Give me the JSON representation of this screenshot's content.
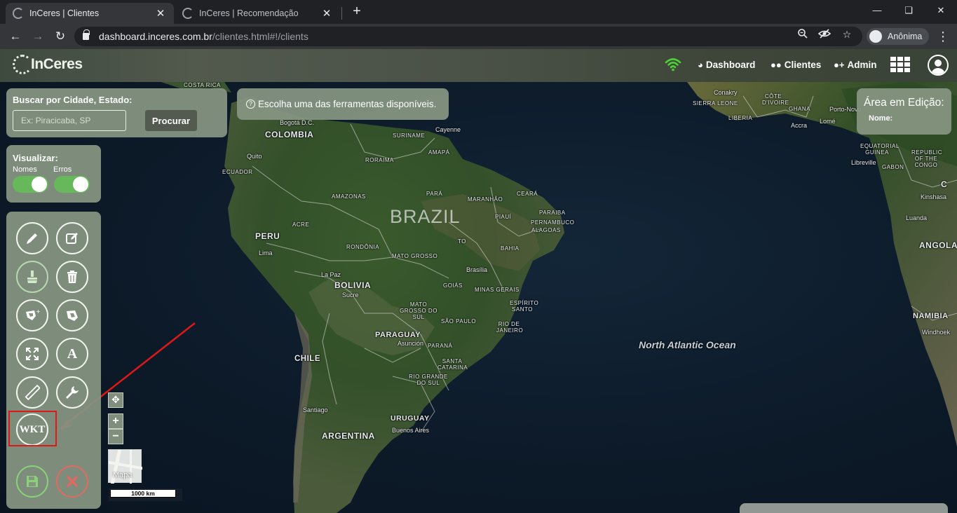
{
  "browser": {
    "tabs": [
      {
        "title": "InCeres | Clientes",
        "close": "✕"
      },
      {
        "title": "InCeres | Recomendação",
        "close": "✕"
      }
    ],
    "new_tab": "+",
    "url_host": "dashboard.inceres.com.br",
    "url_path": "/clientes.html#!/clients",
    "profile_label": "Anônima"
  },
  "header": {
    "logo": "InCeres",
    "nav": [
      {
        "label": "Dashboard",
        "icon": "dashboard-icon"
      },
      {
        "label": "Clientes",
        "icon": "users-icon"
      },
      {
        "label": "Admin",
        "icon": "user-plus-icon"
      }
    ],
    "wifi_color": "#4cd137"
  },
  "search": {
    "title": "Buscar por Cidade, Estado:",
    "placeholder": "Ex: Piracicaba, SP",
    "value": "",
    "button": "Procurar"
  },
  "hint": {
    "text": "Escolha uma das ferramentas disponíveis."
  },
  "view": {
    "title": "Visualizar:",
    "toggles": [
      {
        "label": "Nomes",
        "on": true
      },
      {
        "label": "Erros",
        "on": true
      }
    ]
  },
  "tools": {
    "buttons": [
      "pencil-icon",
      "edit-icon",
      "paint-icon",
      "trash-icon",
      "polygon-add-icon",
      "polygon-cut-icon",
      "expand-icon",
      "text-icon",
      "ruler-icon",
      "wrench-icon",
      "wkt-icon",
      "save-icon",
      "cancel-icon"
    ],
    "text_label": "A",
    "wkt_label": "WKT"
  },
  "edit_area": {
    "title": "Área em Edição:",
    "name_label": "Nome:",
    "name_value": ""
  },
  "map": {
    "controls": {
      "zoom_in": "+",
      "zoom_out": "−",
      "pan": "✥"
    },
    "minimap_label": "Mapa",
    "scale_label": "1000 km",
    "labels": {
      "costa_rica": "COSTA RICA",
      "bogota": "Bogotá D.C.",
      "colombia": "COLOMBIA",
      "quito": "Quito",
      "ecuador": "ECUADOR",
      "peru": "PERU",
      "lima": "Lima",
      "suriname": "SURINAME",
      "cayenne": "Cayenne",
      "amapa": "AMAPÁ",
      "roraima": "RORAIMA",
      "amazonas": "AMAZONAS",
      "para": "PARÁ",
      "maranhao": "MARANHÃO",
      "ceara": "CEARÁ",
      "piaui": "PIAUÍ",
      "paraiba": "PARAIBA",
      "pernambuco": "PERNAMBUCO",
      "alagoas": "ALAGOAS",
      "brazil": "BRAZIL",
      "acre": "ACRE",
      "rondonia": "RONDÔNIA",
      "to": "TO",
      "bahia": "BAHIA",
      "mato_grosso": "MATO GROSSO",
      "la_paz": "La Paz",
      "bolivia": "BOLIVIA",
      "sucre": "Sucre",
      "brasilia": "Brasília",
      "goias": "GOIÁS",
      "minas_gerais": "MINAS GERAIS",
      "espirito_santo": "ESPÍRITO SANTO",
      "ms": "MATO GROSSO DO SUL",
      "sao_paulo": "SÃO PAULO",
      "rio": "RIO DE JANEIRO",
      "paraguay": "PARAGUAY",
      "asuncion": "Asunción",
      "parana": "PARANÁ",
      "santa_catarina": "SANTA CATARINA",
      "rs": "RIO GRANDE DO SUL",
      "chile": "CHILE",
      "santiago": "Santiago",
      "uruguay": "URUGUAY",
      "buenos_aires": "Buenos Aires",
      "argentina": "ARGENTINA",
      "ocean": "North Atlantic Ocean",
      "conakry": "Conakry",
      "sierra_leone": "SIERRA LEONE",
      "liberia": "LIBERIA",
      "cote_divoire": "CÔTE D'IVOIRE",
      "ghana": "GHANA",
      "accra": "Accra",
      "lome": "Lomé",
      "porto_novo": "Porto-Novo",
      "eq_guinea": "EQUATORIAL GUINEA",
      "libreville": "Libreville",
      "gabon": "GABON",
      "congo": "REPUBLIC OF THE CONGO",
      "kinshasa": "Kinshasa",
      "luanda": "Luanda",
      "angola": "ANGOLA",
      "namibia": "NAMIBIA",
      "windhoek": "Windhoek",
      "c": "C"
    }
  }
}
